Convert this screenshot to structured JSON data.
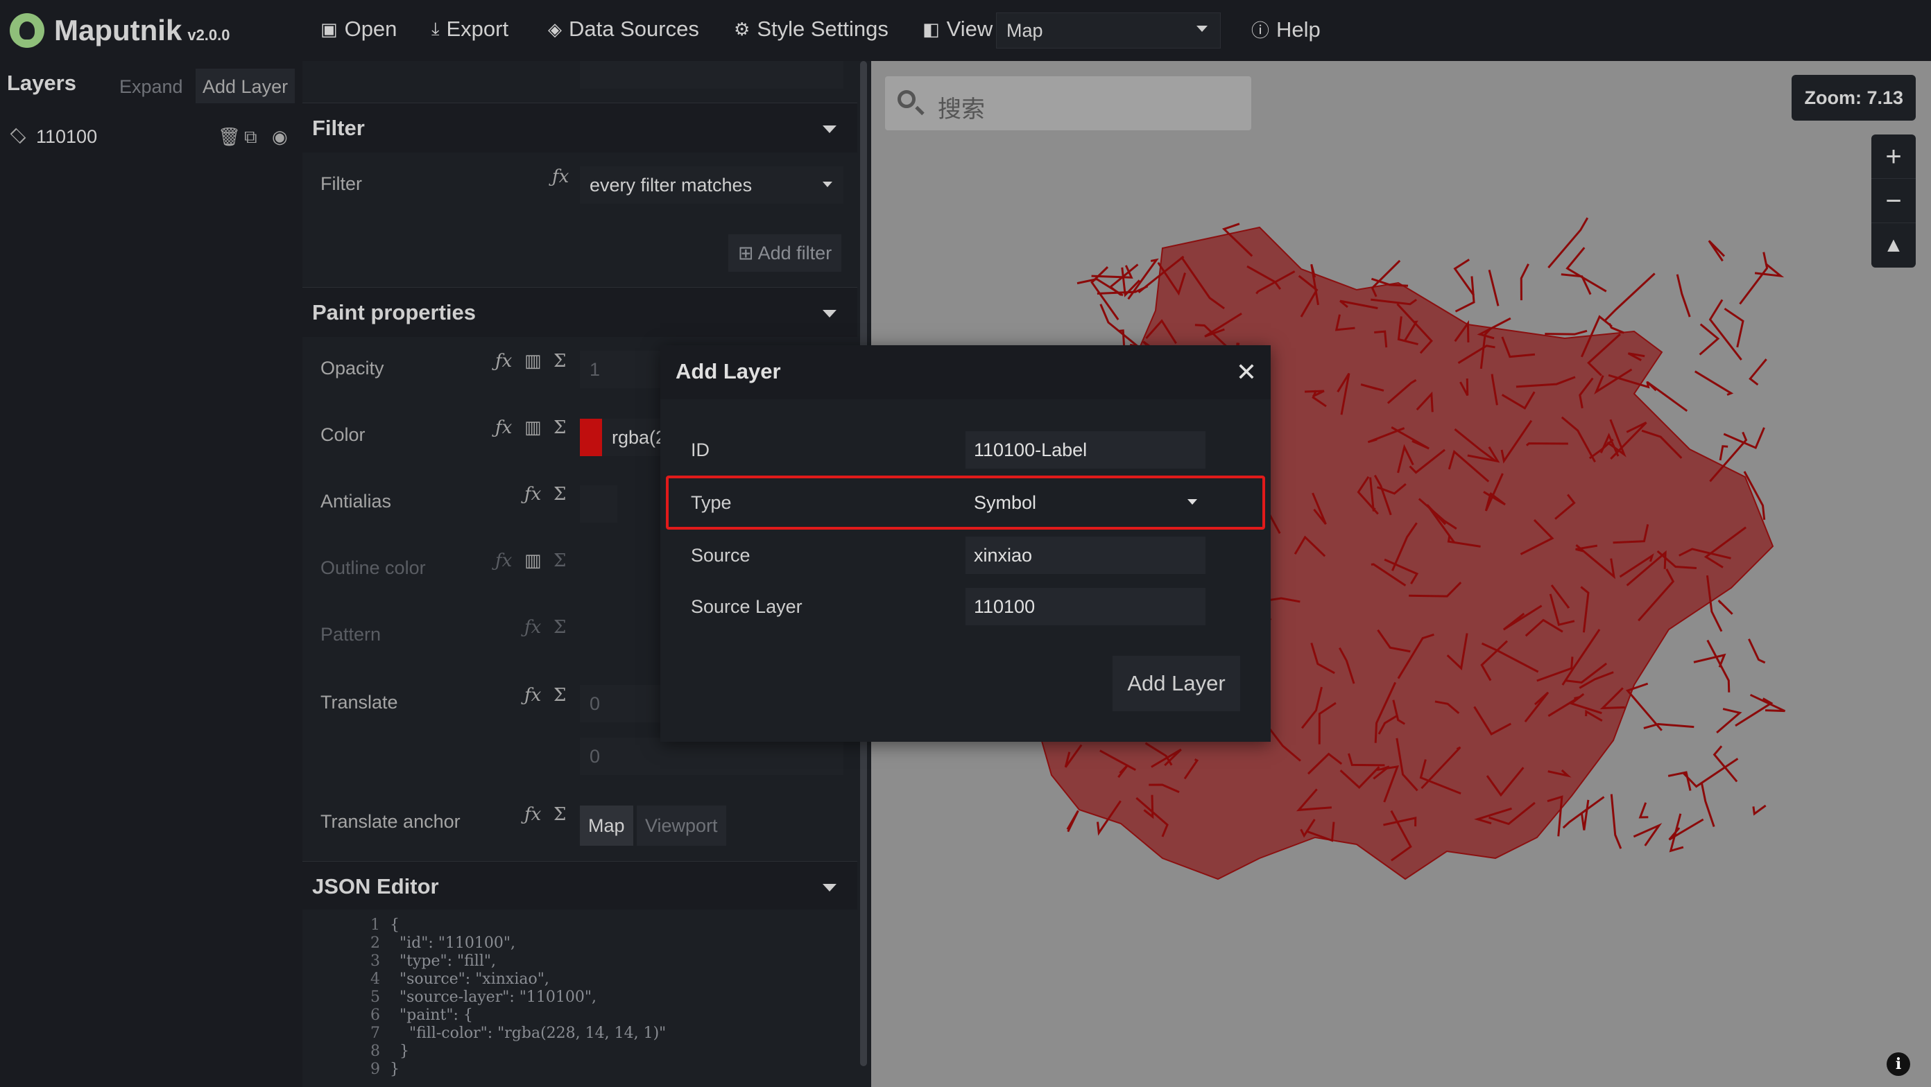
{
  "app": {
    "title": "Maputnik",
    "version": "v2.0.0"
  },
  "toolbar": {
    "open": "Open",
    "export": "Export",
    "data_sources": "Data Sources",
    "style_settings": "Style Settings",
    "view": "View",
    "view_select": "Map",
    "help": "Help"
  },
  "layers_panel": {
    "title": "Layers",
    "expand": "Expand",
    "add_layer": "Add Layer",
    "layers": [
      {
        "name": "110100"
      }
    ]
  },
  "editor": {
    "filter_section": {
      "title": "Filter",
      "filter_label": "Filter",
      "filter_value": "every filter matches",
      "add_filter": "Add filter"
    },
    "paint_section": {
      "title": "Paint properties",
      "opacity_label": "Opacity",
      "opacity_value": "1",
      "color_label": "Color",
      "color_value": "rgba(2",
      "antialias_label": "Antialias",
      "outline_color_label": "Outline color",
      "pattern_label": "Pattern",
      "translate_label": "Translate",
      "translate_x": "0",
      "translate_y": "0",
      "translate_anchor_label": "Translate anchor",
      "anchor_map": "Map",
      "anchor_viewport": "Viewport"
    },
    "json_section": {
      "title": "JSON Editor",
      "lines": [
        "{",
        "  \"id\": \"110100\",",
        "  \"type\": \"fill\",",
        "  \"source\": \"xinxiao\",",
        "  \"source-layer\": \"110100\",",
        "  \"paint\": {",
        "    \"fill-color\": \"rgba(228, 14, 14, 1)\"",
        "  }",
        "}"
      ]
    }
  },
  "map": {
    "search_placeholder": "搜索",
    "zoom_label": "Zoom: 7.13",
    "fill_color": "#8b0a0a"
  },
  "modal": {
    "title": "Add Layer",
    "id_label": "ID",
    "id_value": "110100-Label",
    "type_label": "Type",
    "type_value": "Symbol",
    "source_label": "Source",
    "source_value": "xinxiao",
    "source_layer_label": "Source Layer",
    "source_layer_value": "110100",
    "submit": "Add Layer"
  }
}
